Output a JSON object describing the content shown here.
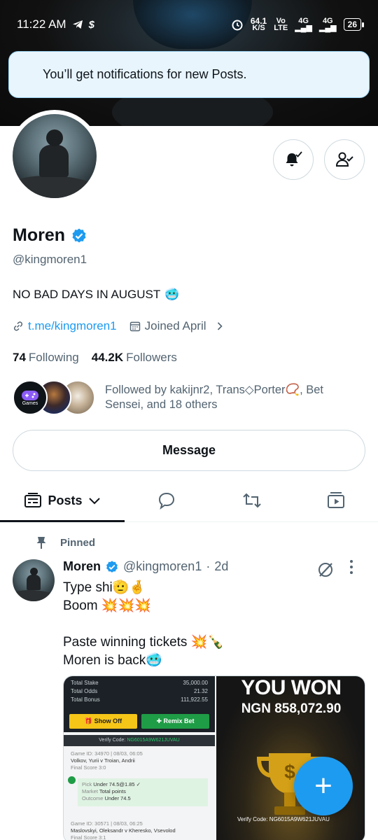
{
  "status_bar": {
    "time": "11:22 AM",
    "speed_value": "64.1",
    "speed_unit": "K/S",
    "carrier_top": "Vo",
    "carrier_bottom": "LTE",
    "sim1": "4G",
    "sim2": "4G",
    "battery": "26"
  },
  "toast": {
    "text": "You’ll get notifications for new Posts."
  },
  "profile": {
    "name": "Moren",
    "handle": "@kingmoren1",
    "bio": "NO BAD DAYS IN AUGUST",
    "bio_emoji": "🥶",
    "link": "t.me/kingmoren1",
    "joined": "Joined April",
    "following_count": "74",
    "following_label": "Following",
    "followers_count": "44.2K",
    "followers_label": "Followers",
    "followed_by": "Followed by kakijnr2, Trans◇Porter📿, Bet Sensei, and 18 others",
    "facepile_label": "Games",
    "message_label": "Message"
  },
  "tabs": {
    "posts_label": "Posts"
  },
  "post": {
    "pinned_label": "Pinned",
    "author_name": "Moren",
    "author_handle": "@kingmoren1",
    "separator": "·",
    "time": "2d",
    "lines": [
      "Type shi🫡🤞",
      "Boom 💥💥💥",
      "",
      "Paste winning tickets 💥🍾",
      "Moren is back🥶"
    ]
  },
  "media": {
    "ticket": {
      "total_stake_label": "Total Stake",
      "total_stake": "35,000.00",
      "total_odds_label": "Total Odds",
      "total_odds": "21.32",
      "total_bonus_label": "Total Bonus",
      "total_bonus": "111,922.55",
      "show_off": "🎁 Show Off",
      "remix": "✚ Remix Bet",
      "verify_label": "Verify Code:",
      "verify_code": "NG6015A9W621JUVAU",
      "game1_id": "Game ID: 34970 | 08/03, 06:05",
      "game1_teams": "Volkov, Yurii v Troian, Andrii",
      "game1_score": "Final Score 3:0",
      "pick_label": "Pick",
      "pick_value": "Under 74.5@1.85 ✓",
      "market_label": "Market",
      "market_value": "Total points",
      "outcome_label": "Outcome",
      "outcome_value": "Under 74.5",
      "game2_id": "Game ID: 30571 | 08/03, 06:25",
      "game2_teams": "Maslovskyi, Oleksandr v Kheresko, Vsevolod",
      "game2_score": "Final Score 3:1"
    },
    "won": {
      "title": "YOU WON",
      "amount": "NGN 858,072.90",
      "code": "Verify Code: NG6015A9W621JUVAU"
    }
  },
  "fab": {
    "label": "+"
  },
  "colors": {
    "accent": "#1d9bf0",
    "text": "#0f1419",
    "muted": "#536471",
    "border": "#cfd9de"
  }
}
